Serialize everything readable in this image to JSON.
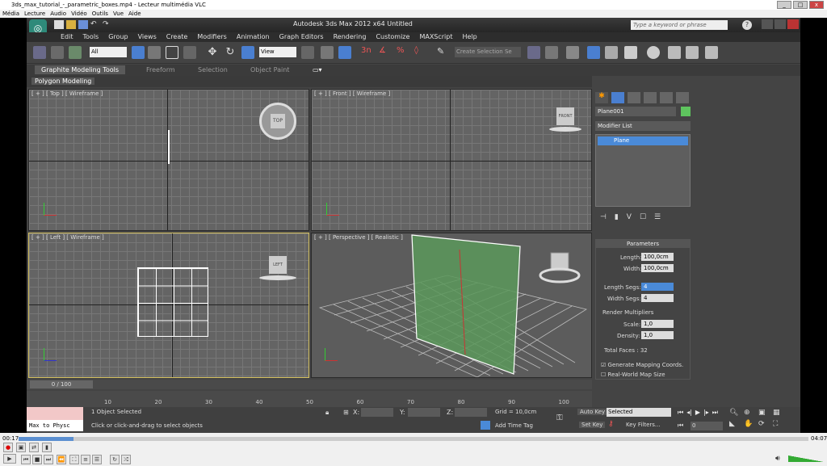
{
  "vlc": {
    "title": "3ds_max_tutorial_-_parametric_boxes.mp4 - Lecteur multimédia VLC",
    "menu": [
      "Média",
      "Lecture",
      "Audio",
      "Vidéo",
      "Outils",
      "Vue",
      "Aide"
    ],
    "time_elapsed": "00:17",
    "time_total": "04:07",
    "progress": 0.07
  },
  "app": {
    "title": "Autodesk 3ds Max  2012 x64    Untitled",
    "search_placeholder": "Type a keyword or phrase",
    "menu": [
      "Edit",
      "Tools",
      "Group",
      "Views",
      "Create",
      "Modifiers",
      "Animation",
      "Graph Editors",
      "Rendering",
      "Customize",
      "MAXScript",
      "Help"
    ],
    "filter_select": "All",
    "view_select": "View",
    "selection_set": "Create Selection Se",
    "ribbon_tabs": [
      "Graphite Modeling Tools",
      "Freeform",
      "Selection",
      "Object Paint"
    ],
    "ribbon_sub": "Polygon Modeling"
  },
  "viewports": {
    "top": "[ + ] [ Top ] [ Wireframe ]",
    "front": "[ + ] [ Front ] [ Wireframe ]",
    "left": "[ + ] [ Left ] [ Wireframe ]",
    "perspective": "[ + ] [ Perspective ] [ Realistic ]",
    "cube_top": "TOP",
    "cube_front": "FRONT",
    "cube_left": "LEFT"
  },
  "command_panel": {
    "object_name": "Plane001",
    "object_color": "#5ec45e",
    "modifier_list": "Modifier List",
    "stack_item": "Plane",
    "rollout": "Parameters",
    "length_label": "Length:",
    "length_value": "100,0cm",
    "width_label": "Width:",
    "width_value": "100,0cm",
    "length_segs_label": "Length Segs:",
    "length_segs_value": "4",
    "width_segs_label": "Width Segs:",
    "width_segs_value": "4",
    "render_multipliers": "Render Multipliers",
    "scale_label": "Scale:",
    "scale_value": "1,0",
    "density_label": "Density:",
    "density_value": "1,0",
    "total_faces": "Total Faces : 32",
    "gen_mapping": "Generate Mapping Coords.",
    "real_world": "Real-World Map Size"
  },
  "timeline": {
    "slider": "0 / 100",
    "ticks": [
      "10",
      "20",
      "30",
      "40",
      "50",
      "60",
      "70",
      "80",
      "90",
      "100"
    ]
  },
  "status": {
    "max_to_physc": "Max to Physc",
    "selected": "1 Object Selected",
    "prompt": "Click or click-and-drag to select objects",
    "x_label": "X:",
    "y_label": "Y:",
    "z_label": "Z:",
    "grid": "Grid = 10,0cm",
    "add_time_tag": "Add Time Tag",
    "auto_key": "Auto Key",
    "set_key": "Set Key",
    "key_select": "Selected",
    "key_filters": "Key Filters...",
    "frame": "0"
  }
}
